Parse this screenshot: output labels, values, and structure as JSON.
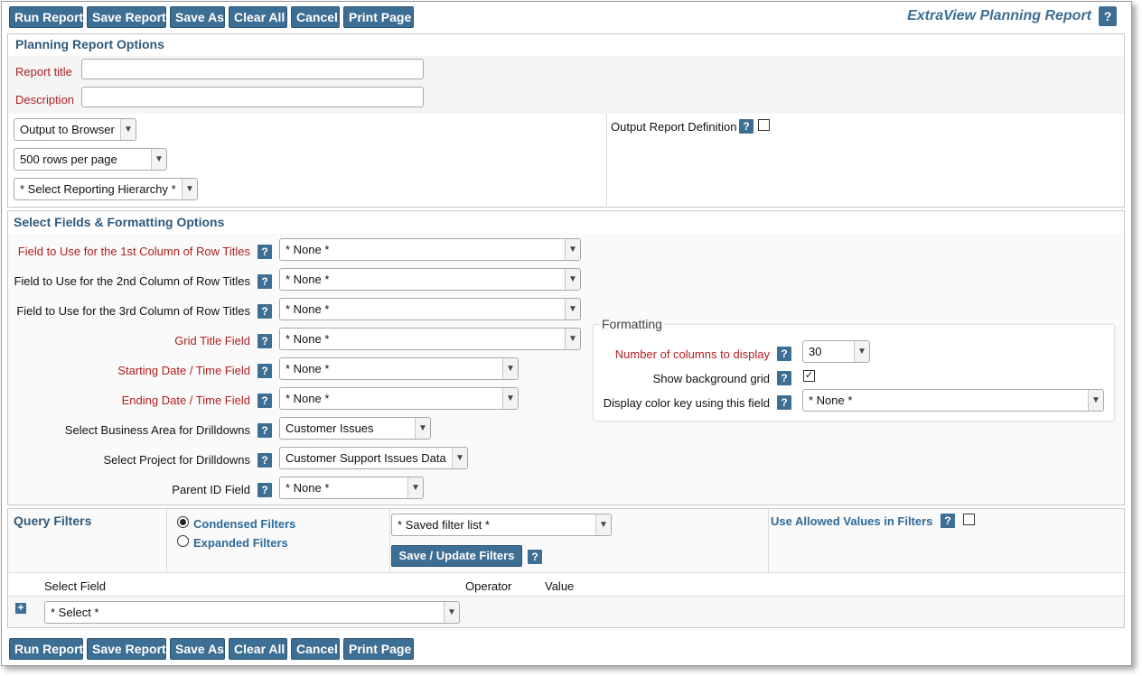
{
  "toolbar": {
    "buttons": [
      "Run Report",
      "Save Report",
      "Save As",
      "Clear All",
      "Cancel",
      "Print Page"
    ],
    "title": "ExtraView Planning Report",
    "help": "?"
  },
  "options": {
    "section_title": "Planning Report Options",
    "report_title_label": "Report title",
    "report_title_value": "",
    "description_label": "Description",
    "description_value": "",
    "output_select": "Output to Browser",
    "rows_select": "500 rows per page",
    "hierarchy_select": "* Select Reporting Hierarchy *",
    "output_definition_label": "Output Report Definition",
    "output_definition_checked": false
  },
  "fields": {
    "section_title": "Select Fields & Formatting Options",
    "rows": [
      {
        "label": "Field to Use for the 1st Column of Row Titles",
        "value": "* None *",
        "required": true
      },
      {
        "label": "Field to Use for the 2nd Column of Row Titles",
        "value": "* None *",
        "required": false
      },
      {
        "label": "Field to Use for the 3rd Column of Row Titles",
        "value": "* None *",
        "required": false
      },
      {
        "label": "Grid Title Field",
        "value": "* None *",
        "required": true
      },
      {
        "label": "Starting Date / Time Field",
        "value": "* None *",
        "required": true
      },
      {
        "label": "Ending Date / Time Field",
        "value": "* None *",
        "required": true
      },
      {
        "label": "Select Business Area for Drilldowns",
        "value": "Customer Issues",
        "required": false
      },
      {
        "label": "Select Project for Drilldowns",
        "value": "Customer Support Issues Data",
        "required": false
      },
      {
        "label": "Parent ID Field",
        "value": "* None *",
        "required": false
      }
    ],
    "formatting": {
      "legend": "Formatting",
      "columns_label": "Number of columns to display",
      "columns_value": "30",
      "grid_label": "Show background grid",
      "grid_checked": true,
      "color_key_label": "Display color key using this field",
      "color_key_value": "* None *"
    }
  },
  "filters": {
    "section_title": "Query Filters",
    "condensed_label": "Condensed Filters",
    "expanded_label": "Expanded Filters",
    "mode": "condensed",
    "saved_filter_select": "* Saved filter list *",
    "save_update_button": "Save / Update Filters",
    "allowed_values_label": "Use Allowed Values in Filters",
    "allowed_values_checked": false,
    "columns": {
      "field": "Select Field",
      "operator": "Operator",
      "value": "Value"
    },
    "field_select": "* Select *",
    "add_icon": "plus-icon"
  },
  "colors": {
    "button": "#3d6e93",
    "section_title": "#2e5a7d",
    "required_label": "#b01e1e",
    "link": "#2e6a9a"
  }
}
